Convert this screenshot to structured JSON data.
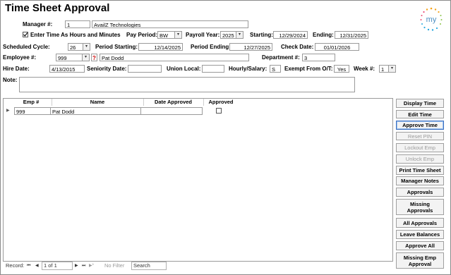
{
  "title": "Time Sheet Approval",
  "header": {
    "manager_label": "Manager #:",
    "manager_id": "1",
    "manager_company": "AvailZ Technologies",
    "enter_hours_label": "Enter Time As Hours and Minutes",
    "enter_hours_checked": true,
    "pay_period_label": "Pay Period:",
    "pay_period": "BW",
    "payroll_year_label": "Payroll Year:",
    "payroll_year": "2025",
    "starting_label": "Starting:",
    "starting": "12/29/2024",
    "ending_label": "Ending:",
    "ending": "12/31/2025",
    "scheduled_cycle_label": "Scheduled Cycle:",
    "scheduled_cycle": "26",
    "period_starting_label": "Period Starting:",
    "period_starting": "12/14/2025",
    "period_ending_label": "Period Ending:",
    "period_ending": "12/27/2025",
    "check_date_label": "Check Date:",
    "check_date": "01/01/2026",
    "employee_label": "Employee #:",
    "employee_id": "999",
    "help_mark": "?",
    "employee_name": "Pat Dodd",
    "department_label": "Department #:",
    "department": "3",
    "hire_date_label": "Hire Date:",
    "hire_date": "4/13/2015",
    "seniority_label": "Seniority Date:",
    "seniority_date": "",
    "union_label": "Union Local:",
    "union_local": "",
    "hourly_label": "Hourly/Salary:",
    "hourly": "S",
    "exempt_label": "Exempt From O/T:",
    "exempt": "Yes",
    "week_label": "Week #:",
    "week": "1",
    "note_label": "Note:",
    "note": ""
  },
  "grid": {
    "columns": [
      "Emp #",
      "Name",
      "Date Approved",
      "Approved"
    ],
    "rows": [
      {
        "emp": "999",
        "name": "Pat Dodd",
        "date_approved": "",
        "approved": false
      }
    ]
  },
  "navigator": {
    "record_label": "Record:",
    "first": "⏮",
    "prev": "◀",
    "position": "1 of 1",
    "next": "▶",
    "last": "⏭",
    "new": "▶*",
    "filter": "No Filter",
    "search": "Search"
  },
  "buttons": [
    {
      "label": "Display Time",
      "enabled": true
    },
    {
      "label": "Edit Time",
      "enabled": true
    },
    {
      "label": "Approve Time",
      "enabled": true
    },
    {
      "label": "Reset PIN",
      "enabled": false
    },
    {
      "label": "Lockout Emp",
      "enabled": false
    },
    {
      "label": "Unlock Emp",
      "enabled": false
    },
    {
      "label": "Print Time Sheet",
      "enabled": true
    },
    {
      "label": "Manager Notes",
      "enabled": true
    },
    {
      "label": "Approvals",
      "enabled": true
    },
    {
      "label": "Missing Approvals",
      "enabled": true
    },
    {
      "label": "All Approvals",
      "enabled": true
    },
    {
      "label": "Leave Balances",
      "enabled": true
    },
    {
      "label": "Approve All",
      "enabled": true
    },
    {
      "label": "Missing Emp Approval",
      "enabled": true
    }
  ],
  "logo_text": "my",
  "colors": {
    "logo_text": "#4a8ec2",
    "accent": "#3c6fbf",
    "help_mark": "#cc0000"
  }
}
